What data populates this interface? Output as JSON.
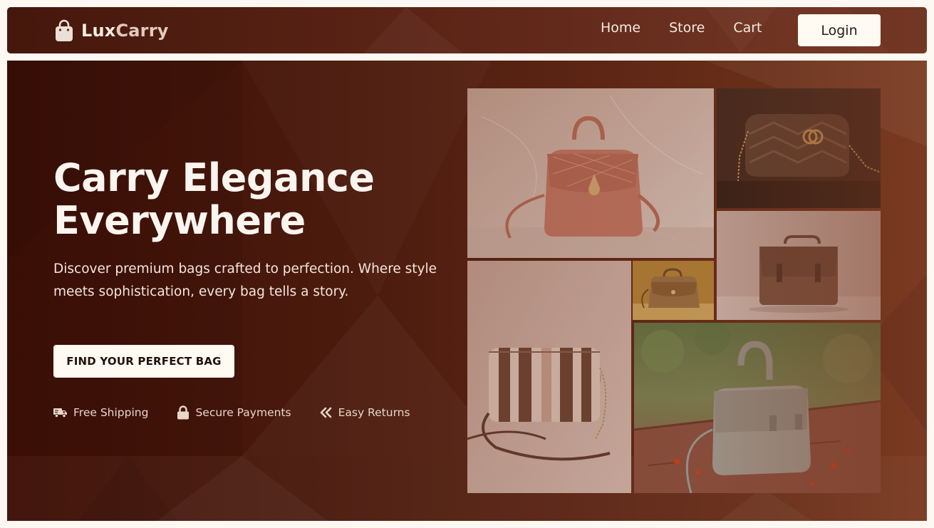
{
  "brand": {
    "name_part1": "Lux",
    "name_part2": "Carry",
    "icon": "shopping-bag-icon"
  },
  "nav": {
    "links": [
      {
        "label": "Home"
      },
      {
        "label": "Store"
      },
      {
        "label": "Cart"
      }
    ],
    "login_label": "Login"
  },
  "hero": {
    "title_line1": "Carry Elegance",
    "title_line2": "Everywhere",
    "subtitle": "Discover premium bags crafted to perfection. Where style meets sophistication, every bag tells a story.",
    "cta_label": "FIND YOUR PERFECT BAG",
    "features": [
      {
        "icon": "truck-icon",
        "label": "Free Shipping"
      },
      {
        "icon": "lock-icon",
        "label": "Secure Payments"
      },
      {
        "icon": "double-chevron-left-icon",
        "label": "Easy Returns"
      }
    ]
  },
  "collage": {
    "images": [
      {
        "name": "pink-quilted-handbag-image"
      },
      {
        "name": "black-chevron-crossbody-image"
      },
      {
        "name": "brown-satchel-image"
      },
      {
        "name": "tan-leather-handbag-image"
      },
      {
        "name": "striped-crossbody-image"
      },
      {
        "name": "grey-top-handle-bag-image"
      }
    ]
  },
  "colors": {
    "primary_dark": "#3d0f06",
    "primary_brown": "#6b3019",
    "cream": "#fffaf2",
    "text_light": "#f5ebe0"
  }
}
